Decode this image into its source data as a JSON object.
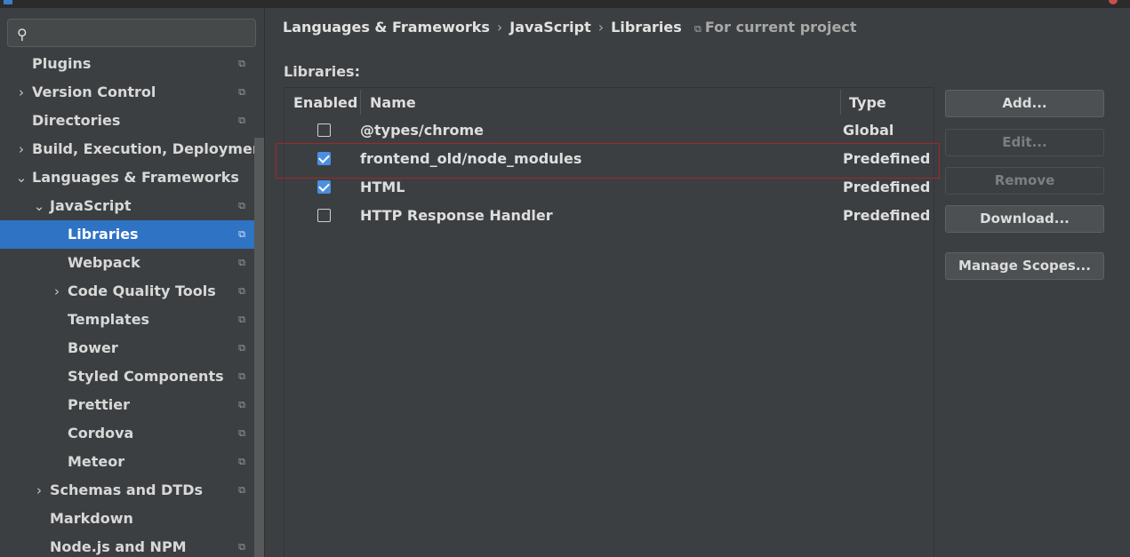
{
  "search": {
    "value": "",
    "placeholder": ""
  },
  "tree": [
    {
      "label": "Plugins",
      "arrow": "",
      "level": 0,
      "config": true,
      "selected": false
    },
    {
      "label": "Version Control",
      "arrow": "›",
      "level": 0,
      "config": true,
      "selected": false
    },
    {
      "label": "Directories",
      "arrow": "",
      "level": 0,
      "config": true,
      "selected": false
    },
    {
      "label": "Build, Execution, Deployment",
      "arrow": "›",
      "level": 0,
      "config": false,
      "selected": false
    },
    {
      "label": "Languages & Frameworks",
      "arrow": "⌄",
      "level": 0,
      "config": false,
      "selected": false
    },
    {
      "label": "JavaScript",
      "arrow": "⌄",
      "level": 1,
      "config": true,
      "selected": false
    },
    {
      "label": "Libraries",
      "arrow": "",
      "level": 2,
      "config": true,
      "selected": true
    },
    {
      "label": "Webpack",
      "arrow": "",
      "level": 2,
      "config": true,
      "selected": false
    },
    {
      "label": "Code Quality Tools",
      "arrow": "›",
      "level": 2,
      "config": true,
      "selected": false
    },
    {
      "label": "Templates",
      "arrow": "",
      "level": 2,
      "config": true,
      "selected": false
    },
    {
      "label": "Bower",
      "arrow": "",
      "level": 2,
      "config": true,
      "selected": false
    },
    {
      "label": "Styled Components",
      "arrow": "",
      "level": 2,
      "config": true,
      "selected": false
    },
    {
      "label": "Prettier",
      "arrow": "",
      "level": 2,
      "config": true,
      "selected": false
    },
    {
      "label": "Cordova",
      "arrow": "",
      "level": 2,
      "config": true,
      "selected": false
    },
    {
      "label": "Meteor",
      "arrow": "",
      "level": 2,
      "config": true,
      "selected": false
    },
    {
      "label": "Schemas and DTDs",
      "arrow": "›",
      "level": 1,
      "config": true,
      "selected": false
    },
    {
      "label": "Markdown",
      "arrow": "",
      "level": 1,
      "config": false,
      "selected": false
    },
    {
      "label": "Node.js and NPM",
      "arrow": "",
      "level": 1,
      "config": true,
      "selected": false
    }
  ],
  "breadcrumb": [
    "Languages & Frameworks",
    "JavaScript",
    "Libraries"
  ],
  "scope_label": "For current project",
  "libraries_label": "Libraries:",
  "table": {
    "columns": [
      "Enabled",
      "Name",
      "Type"
    ],
    "rows": [
      {
        "enabled": false,
        "name": "@types/chrome",
        "type": "Global"
      },
      {
        "enabled": true,
        "name": "frontend_old/node_modules",
        "type": "Predefined"
      },
      {
        "enabled": true,
        "name": "HTML",
        "type": "Predefined"
      },
      {
        "enabled": false,
        "name": "HTTP Response Handler",
        "type": "Predefined"
      }
    ]
  },
  "buttons": {
    "add": "Add...",
    "edit": "Edit...",
    "remove": "Remove",
    "download": "Download...",
    "manage_scopes": "Manage Scopes..."
  },
  "icons": {
    "search": "search-icon",
    "config": "project-config-icon",
    "chevron_right": "chevron-right-icon",
    "chevron_down": "chevron-down-icon"
  },
  "colors": {
    "selection": "#2f73c5",
    "checkbox_on": "#4a8fe0",
    "highlight": "#a3262a"
  }
}
